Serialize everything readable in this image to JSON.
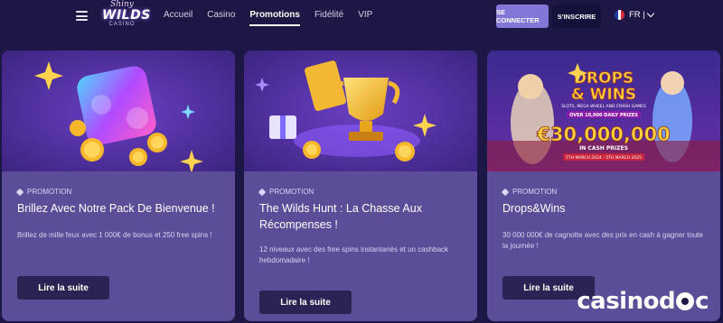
{
  "header": {
    "logo": {
      "line1": "Shiny",
      "line2": "WILDS",
      "line3": "CASINO"
    },
    "nav": [
      {
        "label": "Accueil",
        "active": false
      },
      {
        "label": "Casino",
        "active": false
      },
      {
        "label": "Promotions",
        "active": true
      },
      {
        "label": "Fidélité",
        "active": false
      },
      {
        "label": "VIP",
        "active": false
      }
    ],
    "login_label": "SE CONNECTER",
    "signup_label": "S'INSCRIRE",
    "language": "FR |"
  },
  "cards": [
    {
      "tag": "PROMOTION",
      "title": "Brillez Avec Notre Pack De Bienvenue !",
      "description": "Brillez de mille feux avec 1 000€ de bonus et 250 free spins !",
      "button_label": "Lire la suite"
    },
    {
      "tag": "PROMOTION",
      "title": "The Wilds Hunt : La Chasse Aux Récompenses !",
      "description": "12 niveaux avec des free spins instantanés et un cashback hebdomadaire !",
      "button_label": "Lire la suite"
    },
    {
      "tag": "PROMOTION",
      "title": "Drops&Wins",
      "description": "30 000 000€ de cagnotte avec des prix en cash à gagner toute la journée !",
      "button_label": "Lire la suite",
      "banner": {
        "title_line1": "DROPS",
        "title_line2": "& WINS",
        "subtitle": "SLOTS, MEGA WHEEL AND CRASH GAMES",
        "daily": "OVER 10,000 DAILY PRIZES",
        "amount": "€30,000,000",
        "cash": "IN CASH PRIZES",
        "dates": "5TH MARCH 2024 - 5TH MARCH 2025"
      }
    }
  ],
  "watermark": {
    "part1": "casino",
    "part2": "c"
  },
  "colors": {
    "background": "#1c1744",
    "card": "#5b4d97",
    "button": "#2a2354",
    "login": "#8277d6"
  }
}
